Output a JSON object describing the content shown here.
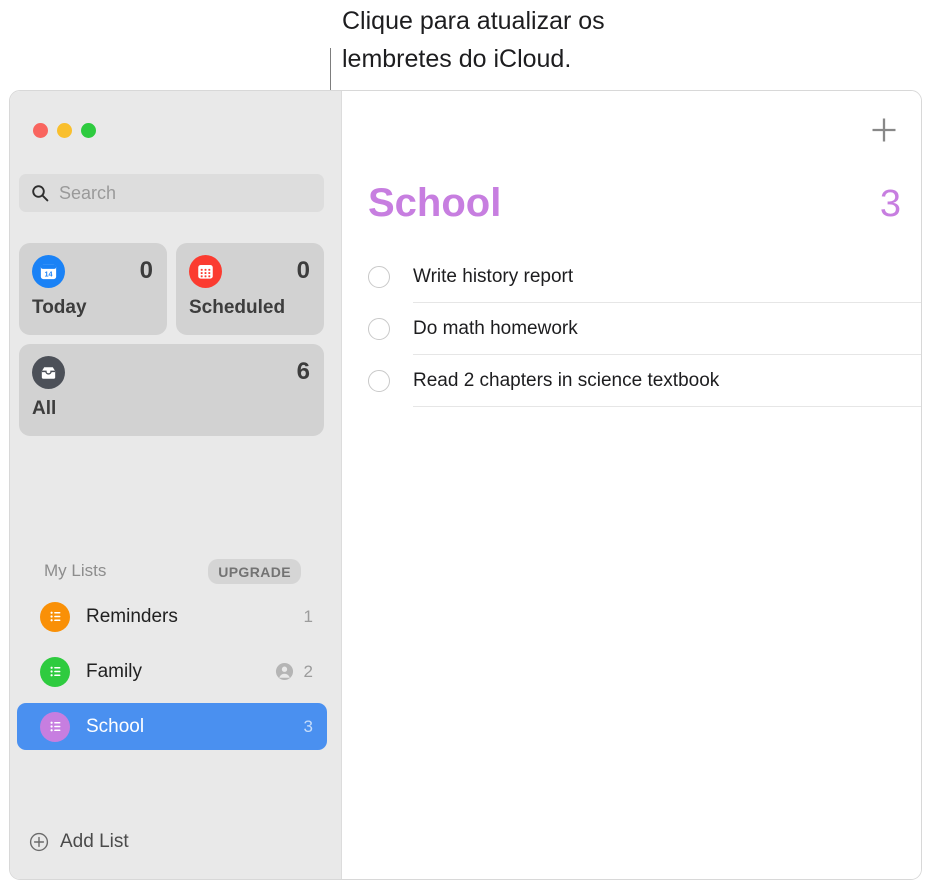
{
  "callout": {
    "text": "Clique para atualizar os\nlembretes do iCloud."
  },
  "window": {
    "traffic_lights": {
      "close_label": "Close",
      "minimize_label": "Minimize",
      "zoom_label": "Zoom"
    }
  },
  "sidebar": {
    "search": {
      "placeholder": "Search",
      "value": "",
      "icon": "search-icon"
    },
    "smart_tiles": [
      {
        "label": "Today",
        "count": "0",
        "icon": "calendar-day-icon",
        "color": "#1a82f6"
      },
      {
        "label": "Scheduled",
        "count": "0",
        "icon": "calendar-grid-icon",
        "color": "#fb3b30"
      },
      {
        "label": "All",
        "count": "6",
        "icon": "inbox-tray-icon",
        "color": "#4c5058"
      }
    ],
    "today_date_number": "14",
    "lists_header": {
      "title": "My Lists",
      "upgrade_label": "UPGRADE"
    },
    "lists": [
      {
        "name": "Reminders",
        "count": "1",
        "color": "#f99007",
        "shared": false,
        "selected": false
      },
      {
        "name": "Family",
        "count": "2",
        "color": "#2ecb3f",
        "shared": true,
        "selected": false
      },
      {
        "name": "School",
        "count": "3",
        "color": "#c77ee0",
        "shared": false,
        "selected": true
      }
    ],
    "add_list_label": "Add List"
  },
  "content": {
    "add_button_label": "+",
    "title": "School",
    "count": "3",
    "accent_color": "#c77ee0",
    "reminders": [
      {
        "text": "Write history report",
        "completed": false
      },
      {
        "text": "Do math homework",
        "completed": false
      },
      {
        "text": "Read 2 chapters in science textbook",
        "completed": false
      }
    ]
  }
}
